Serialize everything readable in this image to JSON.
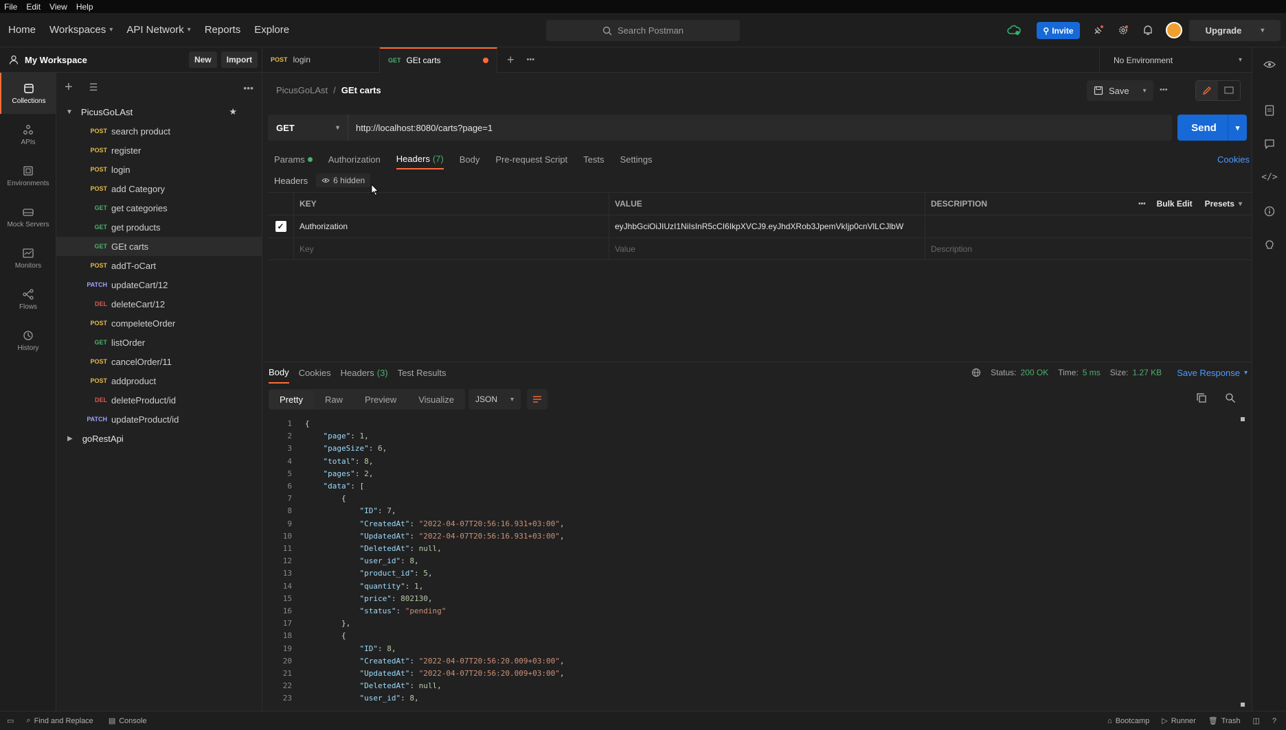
{
  "menu": [
    "File",
    "Edit",
    "View",
    "Help"
  ],
  "nav": {
    "home": "Home",
    "workspaces": "Workspaces",
    "api_network": "API Network",
    "reports": "Reports",
    "explore": "Explore",
    "search_placeholder": "Search Postman",
    "invite": "Invite",
    "upgrade": "Upgrade"
  },
  "workspace": {
    "name": "My Workspace",
    "new": "New",
    "import": "Import"
  },
  "rail": [
    {
      "label": "Collections",
      "icon": "collections-icon"
    },
    {
      "label": "APIs",
      "icon": "apis-icon"
    },
    {
      "label": "Environments",
      "icon": "environments-icon"
    },
    {
      "label": "Mock Servers",
      "icon": "mock-servers-icon"
    },
    {
      "label": "Monitors",
      "icon": "monitors-icon"
    },
    {
      "label": "Flows",
      "icon": "flows-icon"
    },
    {
      "label": "History",
      "icon": "history-icon"
    }
  ],
  "collection": {
    "name": "PicusGoLAst",
    "items": [
      {
        "method": "POST",
        "name": "search product"
      },
      {
        "method": "POST",
        "name": "register"
      },
      {
        "method": "POST",
        "name": "login"
      },
      {
        "method": "POST",
        "name": "add Category"
      },
      {
        "method": "GET",
        "name": "get categories"
      },
      {
        "method": "GET",
        "name": "get products"
      },
      {
        "method": "GET",
        "name": "GEt carts"
      },
      {
        "method": "POST",
        "name": "addT-oCart"
      },
      {
        "method": "PATCH",
        "name": "updateCart/12"
      },
      {
        "method": "DEL",
        "name": "deleteCart/12"
      },
      {
        "method": "POST",
        "name": "compeleteOrder"
      },
      {
        "method": "GET",
        "name": "listOrder"
      },
      {
        "method": "POST",
        "name": "cancelOrder/11"
      },
      {
        "method": "POST",
        "name": "addproduct"
      },
      {
        "method": "DEL",
        "name": "deleteProduct/id"
      },
      {
        "method": "PATCH",
        "name": "updateProduct/id"
      }
    ]
  },
  "collection2": {
    "name": "goRestApi"
  },
  "tabs": [
    {
      "method": "POST",
      "name": "login"
    },
    {
      "method": "GET",
      "name": "GEt carts"
    }
  ],
  "environment": "No Environment",
  "breadcrumb": {
    "parent": "PicusGoLAst",
    "sep": "/",
    "current": "GEt carts"
  },
  "save": "Save",
  "request": {
    "method": "GET",
    "url": "http://localhost:8080/carts?page=1",
    "send": "Send"
  },
  "req_tabs": {
    "params": "Params",
    "authorization": "Authorization",
    "headers": "Headers",
    "headers_count": "(7)",
    "body": "Body",
    "prerequest": "Pre-request Script",
    "tests": "Tests",
    "settings": "Settings",
    "cookies": "Cookies"
  },
  "headers_section": {
    "label": "Headers",
    "hidden": "6 hidden"
  },
  "table": {
    "key": "KEY",
    "value": "VALUE",
    "description": "DESCRIPTION",
    "bulk_edit": "Bulk Edit",
    "presets": "Presets",
    "row": {
      "key": "Authorization",
      "value": "eyJhbGciOiJIUzI1NiIsInR5cCI6IkpXVCJ9.eyJhdXRob3JpemVkIjp0cnVlLCJlbW",
      "checked": true
    },
    "placeholder": {
      "key": "Key",
      "value": "Value",
      "description": "Description"
    }
  },
  "response": {
    "tabs": {
      "body": "Body",
      "cookies": "Cookies",
      "headers": "Headers",
      "headers_count": "(3)",
      "tests": "Test Results"
    },
    "status_label": "Status:",
    "status": "200 OK",
    "time_label": "Time:",
    "time": "5 ms",
    "size_label": "Size:",
    "size": "1.27 KB",
    "save_response": "Save Response",
    "views": {
      "pretty": "Pretty",
      "raw": "Raw",
      "preview": "Preview",
      "visualize": "Visualize"
    },
    "format": "JSON"
  },
  "code_lines": [
    [
      [
        "p",
        "{"
      ]
    ],
    [
      [
        "p",
        "    "
      ],
      [
        "k",
        "\"page\""
      ],
      [
        "p",
        ": "
      ],
      [
        "n",
        "1"
      ],
      [
        "p",
        ","
      ]
    ],
    [
      [
        "p",
        "    "
      ],
      [
        "k",
        "\"pageSize\""
      ],
      [
        "p",
        ": "
      ],
      [
        "n",
        "6"
      ],
      [
        "p",
        ","
      ]
    ],
    [
      [
        "p",
        "    "
      ],
      [
        "k",
        "\"total\""
      ],
      [
        "p",
        ": "
      ],
      [
        "n",
        "8"
      ],
      [
        "p",
        ","
      ]
    ],
    [
      [
        "p",
        "    "
      ],
      [
        "k",
        "\"pages\""
      ],
      [
        "p",
        ": "
      ],
      [
        "n",
        "2"
      ],
      [
        "p",
        ","
      ]
    ],
    [
      [
        "p",
        "    "
      ],
      [
        "k",
        "\"data\""
      ],
      [
        "p",
        ": ["
      ]
    ],
    [
      [
        "p",
        "        {"
      ]
    ],
    [
      [
        "p",
        "            "
      ],
      [
        "k",
        "\"ID\""
      ],
      [
        "p",
        ": "
      ],
      [
        "n",
        "7"
      ],
      [
        "p",
        ","
      ]
    ],
    [
      [
        "p",
        "            "
      ],
      [
        "k",
        "\"CreatedAt\""
      ],
      [
        "p",
        ": "
      ],
      [
        "s",
        "\"2022-04-07T20:56:16.931+03:00\""
      ],
      [
        "p",
        ","
      ]
    ],
    [
      [
        "p",
        "            "
      ],
      [
        "k",
        "\"UpdatedAt\""
      ],
      [
        "p",
        ": "
      ],
      [
        "s",
        "\"2022-04-07T20:56:16.931+03:00\""
      ],
      [
        "p",
        ","
      ]
    ],
    [
      [
        "p",
        "            "
      ],
      [
        "k",
        "\"DeletedAt\""
      ],
      [
        "p",
        ": "
      ],
      [
        "n",
        "null"
      ],
      [
        "p",
        ","
      ]
    ],
    [
      [
        "p",
        "            "
      ],
      [
        "k",
        "\"user_id\""
      ],
      [
        "p",
        ": "
      ],
      [
        "n",
        "8"
      ],
      [
        "p",
        ","
      ]
    ],
    [
      [
        "p",
        "            "
      ],
      [
        "k",
        "\"product_id\""
      ],
      [
        "p",
        ": "
      ],
      [
        "n",
        "5"
      ],
      [
        "p",
        ","
      ]
    ],
    [
      [
        "p",
        "            "
      ],
      [
        "k",
        "\"quantity\""
      ],
      [
        "p",
        ": "
      ],
      [
        "n",
        "1"
      ],
      [
        "p",
        ","
      ]
    ],
    [
      [
        "p",
        "            "
      ],
      [
        "k",
        "\"price\""
      ],
      [
        "p",
        ": "
      ],
      [
        "n",
        "802130"
      ],
      [
        "p",
        ","
      ]
    ],
    [
      [
        "p",
        "            "
      ],
      [
        "k",
        "\"status\""
      ],
      [
        "p",
        ": "
      ],
      [
        "s",
        "\"pending\""
      ]
    ],
    [
      [
        "p",
        "        },"
      ]
    ],
    [
      [
        "p",
        "        {"
      ]
    ],
    [
      [
        "p",
        "            "
      ],
      [
        "k",
        "\"ID\""
      ],
      [
        "p",
        ": "
      ],
      [
        "n",
        "8"
      ],
      [
        "p",
        ","
      ]
    ],
    [
      [
        "p",
        "            "
      ],
      [
        "k",
        "\"CreatedAt\""
      ],
      [
        "p",
        ": "
      ],
      [
        "s",
        "\"2022-04-07T20:56:20.009+03:00\""
      ],
      [
        "p",
        ","
      ]
    ],
    [
      [
        "p",
        "            "
      ],
      [
        "k",
        "\"UpdatedAt\""
      ],
      [
        "p",
        ": "
      ],
      [
        "s",
        "\"2022-04-07T20:56:20.009+03:00\""
      ],
      [
        "p",
        ","
      ]
    ],
    [
      [
        "p",
        "            "
      ],
      [
        "k",
        "\"DeletedAt\""
      ],
      [
        "p",
        ": "
      ],
      [
        "n",
        "null"
      ],
      [
        "p",
        ","
      ]
    ],
    [
      [
        "p",
        "            "
      ],
      [
        "k",
        "\"user_id\""
      ],
      [
        "p",
        ": "
      ],
      [
        "n",
        "8"
      ],
      [
        "p",
        ","
      ]
    ]
  ],
  "footer": {
    "find_replace": "Find and Replace",
    "console": "Console",
    "bootcamp": "Bootcamp",
    "runner": "Runner",
    "trash": "Trash"
  },
  "colors": {
    "accent": "#ff6c37",
    "primary": "#1669d6",
    "status_ok": "#4caf6e",
    "post": "#e5b94b",
    "get": "#4caf6e",
    "patch": "#a1a1ff",
    "delete": "#e5564b"
  }
}
